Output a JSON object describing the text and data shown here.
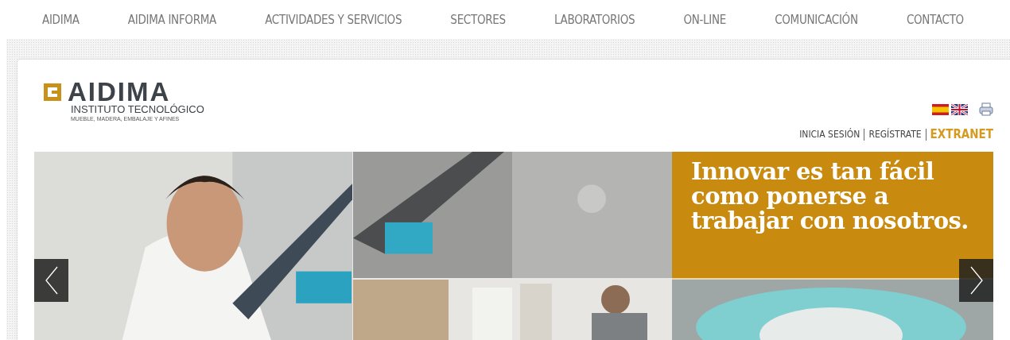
{
  "nav": [
    {
      "label": "AIDIMA"
    },
    {
      "label": "AIDIMA INFORMA"
    },
    {
      "label": "ACTIVIDADES Y SERVICIOS"
    },
    {
      "label": "SECTORES"
    },
    {
      "label": "LABORATORIOS"
    },
    {
      "label": "ON-LINE"
    },
    {
      "label": "COMUNICACIÓN"
    },
    {
      "label": "CONTACTO"
    }
  ],
  "logo": {
    "name": "AIDIMA",
    "subtitle": "INSTITUTO TECNOLÓGICO",
    "tagline": "MUEBLE, MADERA, EMBALAJE Y AFINES"
  },
  "user_links": [
    {
      "label": "INICIA SESIÓN",
      "kind": "plain"
    },
    {
      "label": "REGÍSTRATE",
      "kind": "plain"
    },
    {
      "label": "EXTRANET",
      "kind": "highlight"
    }
  ],
  "slider": {
    "headline": "Innovar es tan fácil como ponerse a trabajar con nosotros."
  }
}
